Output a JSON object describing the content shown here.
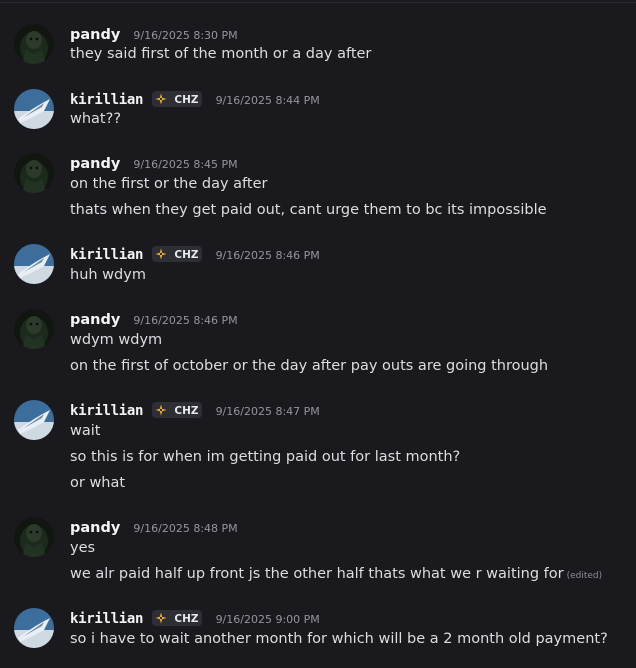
{
  "messages": [
    {
      "user": "pandy",
      "tag": null,
      "time": "9/16/2025 8:30 PM",
      "lines": [
        {
          "text": "they said first of the month or a day after"
        }
      ]
    },
    {
      "user": "kirillian",
      "tag": "CHZ",
      "time": "9/16/2025 8:44 PM",
      "lines": [
        {
          "text": "what??"
        }
      ]
    },
    {
      "user": "pandy",
      "tag": null,
      "time": "9/16/2025 8:45 PM",
      "lines": [
        {
          "text": "on the first or the day after"
        },
        {
          "text": "thats when they get paid out, cant urge them to bc its impossible"
        }
      ]
    },
    {
      "user": "kirillian",
      "tag": "CHZ",
      "time": "9/16/2025 8:46 PM",
      "lines": [
        {
          "text": "huh wdym"
        }
      ]
    },
    {
      "user": "pandy",
      "tag": null,
      "time": "9/16/2025 8:46 PM",
      "lines": [
        {
          "text": "wdym wdym"
        },
        {
          "text": "on the first of october or the day after pay outs are going through"
        }
      ]
    },
    {
      "user": "kirillian",
      "tag": "CHZ",
      "time": "9/16/2025 8:47 PM",
      "lines": [
        {
          "text": "wait"
        },
        {
          "text": "so this is for when im getting paid out for last month?"
        },
        {
          "text": "or what"
        }
      ]
    },
    {
      "user": "pandy",
      "tag": null,
      "time": "9/16/2025 8:48 PM",
      "lines": [
        {
          "text": "yes"
        },
        {
          "text": "we alr paid half up front js the other half thats what we r waiting for",
          "edited": "(edited)"
        }
      ]
    },
    {
      "user": "kirillian",
      "tag": "CHZ",
      "time": "9/16/2025 9:00 PM",
      "lines": [
        {
          "text": "so i have to wait another month for which will be a 2 month old payment?"
        }
      ]
    }
  ],
  "colors": {
    "background": "#1a1a1e",
    "username": "#f2f3f5",
    "message_text": "#dcdde1",
    "timestamp": "#94959c",
    "tag_background": "#2e2f35",
    "tag_icon": "#f0b232"
  },
  "icons": {
    "pandy_avatar": "dark-green-figure-avatar",
    "kirillian_avatar": "sky-blue-bird-avatar",
    "tag_icon": "diamond-sparkle-icon"
  }
}
